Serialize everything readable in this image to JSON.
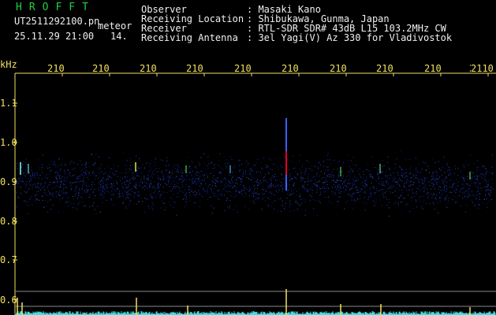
{
  "header": {
    "logo": "HROFFT",
    "filename": "UT2511292100.pn",
    "label_meteor": "meteor",
    "datetime": "25.11.29 21:00",
    "count": "14."
  },
  "info": [
    {
      "label": "Observer",
      "value": ": Masaki Kano"
    },
    {
      "label": "Receiving Location",
      "value": ": Shibukawa, Gunma, Japan"
    },
    {
      "label": "Receiver",
      "value": ": RTL-SDR SDR# 43dB L15 103.2MHz CW"
    },
    {
      "label": "Receiving Antenna",
      "value": ": 3el Yagi(V) Az 330 for Vladivostok"
    }
  ],
  "time_axis": {
    "ticks": [
      "210",
      "210",
      "210",
      "210",
      "210",
      "210",
      "210",
      "210",
      "210",
      "210",
      "2110"
    ]
  },
  "freq_axis": {
    "unit": "kHz",
    "ticks": [
      "1.1",
      "1.0",
      "0.9",
      "0.8",
      "0.7",
      "0.6"
    ]
  },
  "colors": {
    "background": "#000000",
    "text_green": "#20d040",
    "text_white": "#f0f0f0",
    "axis_yellow": "#f0e060",
    "echo_red": "#e0002a",
    "noise_blue": "#1a2fa0",
    "baseline_cyan": "#40e0e0"
  }
}
